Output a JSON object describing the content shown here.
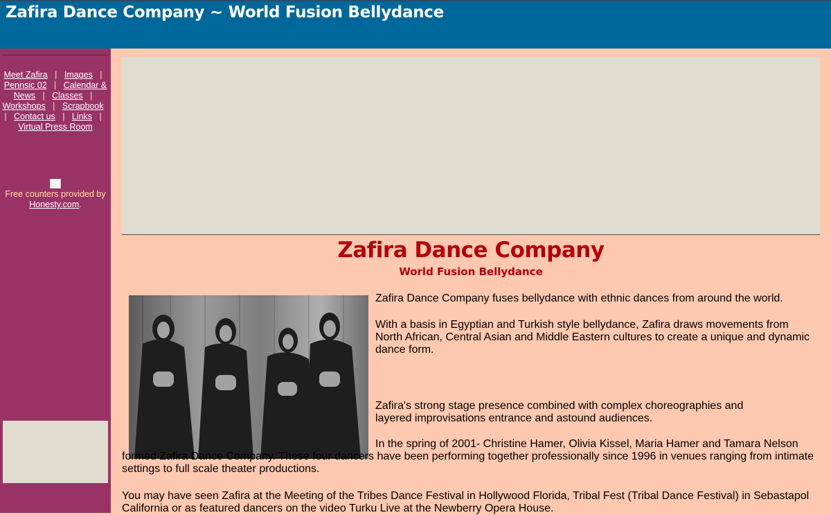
{
  "header": {
    "title": "Zafira Dance Company ~ World Fusion Bellydance"
  },
  "nav": {
    "items": [
      {
        "label": "Meet Zafira"
      },
      {
        "label": "Images"
      },
      {
        "label": "Pennsic 02"
      },
      {
        "label": "Calendar & News"
      },
      {
        "label": "Classes"
      },
      {
        "label": "Workshops"
      },
      {
        "label": "Scrapbook"
      },
      {
        "label": "Contact us"
      },
      {
        "label": "Links"
      },
      {
        "label": "Virtual Press Room"
      }
    ],
    "separator": "|"
  },
  "counter": {
    "text_before": "Free counters provided by ",
    "link": "Honesty.com",
    "text_after": "."
  },
  "main": {
    "title": "Zafira Dance Company",
    "subtitle": "World Fusion Bellydance",
    "paragraphs": [
      "Zafira Dance Company fuses bellydance with ethnic dances from around the world.",
      "With a basis in Egyptian and Turkish style bellydance, Zafira draws movements from North African, Central Asian and Middle Eastern cultures to create a unique and dynamic dance form.",
      "Zafira's strong stage presence combined with complex choreographies and",
      "layered improvisations entrance and astound audiences.",
      "In the spring of 2001- Christine Hamer, Olivia Kissel, Maria Hamer and Tamara Nelson formed Zafira Dance Company. These four dancers have been performing together professionally since 1996 in venues ranging from intimate settings to full scale theater productions.",
      "You may have seen Zafira at the Meeting of the Tribes Dance Festival in Hollywood Florida, Tribal Fest (Tribal Dance Festival) in Sebastapol California or as featured dancers on the video Turku Live at the Newberry Opera House."
    ]
  }
}
